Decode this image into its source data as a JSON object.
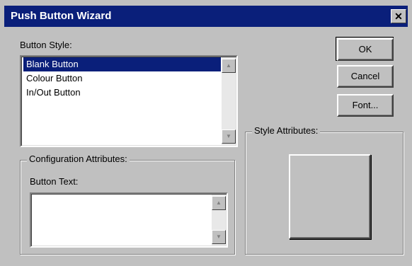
{
  "window": {
    "title": "Push Button Wizard",
    "close_glyph": "✕"
  },
  "button_style": {
    "label": "Button Style:",
    "items": [
      "Blank Button",
      "Colour Button",
      "In/Out Button"
    ],
    "selected_index": 0
  },
  "configuration": {
    "group_label": "Configuration Attributes:",
    "button_text_label": "Button Text:",
    "button_text_value": ""
  },
  "style_attributes": {
    "group_label": "Style Attributes:"
  },
  "buttons": {
    "ok": "OK",
    "cancel": "Cancel",
    "font": "Font..."
  },
  "scroll": {
    "up_glyph": "▲",
    "down_glyph": "▼"
  }
}
